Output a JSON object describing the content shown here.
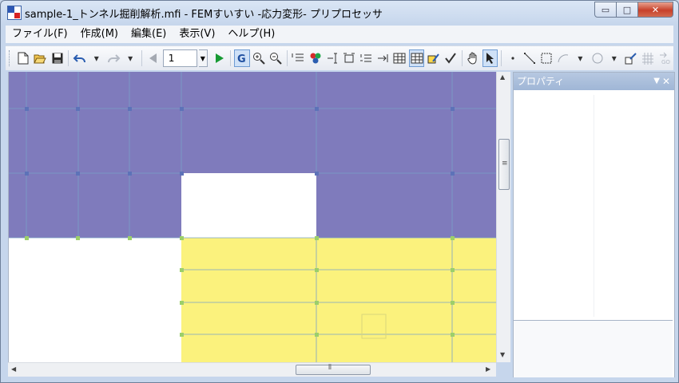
{
  "window": {
    "title": "sample-1_トンネル掘削解析.mfi - FEMすいすい -応力変形- プリプロセッサ",
    "min_symbol": "▭",
    "max_symbol": "□",
    "close_symbol": "✕"
  },
  "menu": {
    "items": [
      {
        "label": "ファイル(F)"
      },
      {
        "label": "作成(M)"
      },
      {
        "label": "編集(E)"
      },
      {
        "label": "表示(V)"
      },
      {
        "label": "ヘルプ(H)"
      }
    ]
  },
  "toolbar": {
    "page_value": "1",
    "icons": [
      "new-file-icon",
      "open-folder-icon",
      "save-icon",
      "undo-icon",
      "redo-icon",
      "prev-icon",
      "play-icon",
      "grid-icon",
      "zoom-in-icon",
      "zoom-out-icon",
      "hand-icon",
      "pointer-icon"
    ]
  },
  "panel": {
    "title": "プロパティ"
  },
  "colors": {
    "ground_upper": "#7f7bbc",
    "ground_lower": "#fbf27d",
    "node_upper": "#5d72b8",
    "node_lower": "#9ccf6a",
    "mesh_line": "#7aa1c8"
  }
}
